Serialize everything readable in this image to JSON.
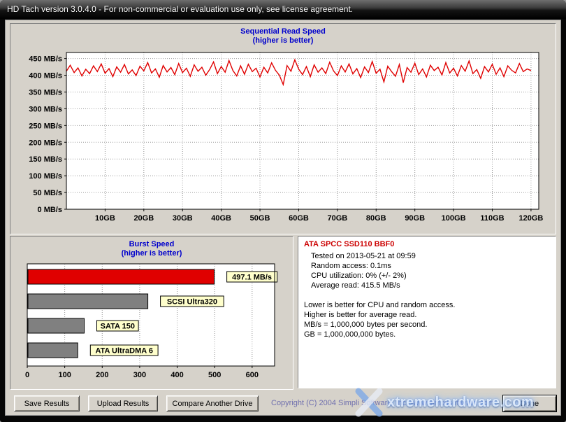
{
  "window": {
    "title": "HD Tach version 3.0.4.0  -  For non-commercial or evaluation use only, see license agreement."
  },
  "info": {
    "drive": "ATA SPCC SSD110 BBF0",
    "lines": [
      "Tested on 2013-05-21 at 09:59",
      "Random access: 0.1ms",
      "CPU utilization: 0% (+/- 2%)",
      "Average read: 415.5 MB/s",
      "",
      "Lower is better for CPU and random access.",
      "Higher is better for average read.",
      "MB/s = 1,000,000 bytes per second.",
      "GB = 1,000,000,000 bytes."
    ]
  },
  "buttons": {
    "save": "Save Results",
    "upload": "Upload Results",
    "compare": "Compare Another Drive",
    "done": "Done"
  },
  "copyright": "Copyright (C) 2004 Simpli Software, Inc.  www.simplisoftware.com",
  "watermark": "xtremehardware.com",
  "colors": {
    "accent_red": "#e00000",
    "bar_gray": "#808080",
    "label_yellow": "#ffffcc",
    "title_blue": "#0000cc"
  },
  "chart_data": [
    {
      "type": "line",
      "title": "Sequential Read Speed",
      "subtitle": "(higher is better)",
      "y_unit": "MB/s",
      "x_unit": "GB",
      "ylim": [
        0,
        450
      ],
      "y_ticks": [
        0,
        50,
        100,
        150,
        200,
        250,
        300,
        350,
        400,
        450
      ],
      "x_ticks": [
        10,
        20,
        30,
        40,
        50,
        60,
        70,
        80,
        90,
        100,
        110,
        120
      ],
      "grid": "dotted",
      "series": [
        {
          "name": "sequential-read",
          "color": "#e00000",
          "x_start": 0,
          "x_step": 1,
          "average": 415.5,
          "values": [
            412,
            430,
            408,
            422,
            398,
            418,
            405,
            428,
            411,
            434,
            406,
            420,
            396,
            425,
            409,
            432,
            404,
            416,
            399,
            427,
            413,
            438,
            407,
            419,
            394,
            429,
            410,
            423,
            402,
            435,
            408,
            421,
            397,
            431,
            412,
            424,
            400,
            417,
            440,
            405,
            426,
            409,
            444,
            414,
            398,
            428,
            403,
            433,
            411,
            421,
            395,
            424,
            407,
            437,
            415,
            400,
            372,
            429,
            412,
            446,
            418,
            402,
            426,
            396,
            431,
            409,
            422,
            405,
            439,
            413,
            399,
            428,
            410,
            434,
            404,
            420,
            393,
            425,
            408,
            441,
            406,
            418,
            380,
            427,
            411,
            397,
            432,
            378,
            423,
            409,
            436,
            402,
            419,
            395,
            430,
            414,
            424,
            401,
            438,
            407,
            421,
            398,
            429,
            412,
            443,
            405,
            417,
            391,
            426,
            410,
            433,
            403,
            422,
            396,
            428,
            415,
            407,
            435,
            411,
            419,
            414
          ]
        }
      ]
    },
    {
      "type": "bar",
      "orientation": "horizontal",
      "title": "Burst Speed",
      "subtitle": "(higher is better)",
      "xlim": [
        0,
        660
      ],
      "x_ticks": [
        0,
        100,
        200,
        300,
        400,
        500,
        600
      ],
      "grid": "dotted",
      "bars": [
        {
          "label": "497.1 MB/s",
          "value": 497.1,
          "color": "#e00000"
        },
        {
          "label": "SCSI Ultra320",
          "value": 320,
          "color": "#808080"
        },
        {
          "label": "SATA 150",
          "value": 150,
          "color": "#808080"
        },
        {
          "label": "ATA UltraDMA 6",
          "value": 133,
          "color": "#808080"
        }
      ]
    }
  ]
}
